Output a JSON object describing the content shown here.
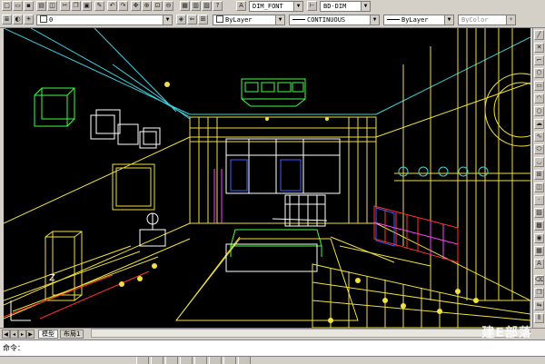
{
  "toolbar": {
    "layer_name": "0",
    "dim_font": "DIM_FONT",
    "dim_style": "BD-DIM",
    "color": "ByLayer",
    "linetype": "CONTINUOUS",
    "lineweight": "ByLayer",
    "plotstyle": "ByColor"
  },
  "tabs": {
    "model": "模型",
    "layout1": "布局1"
  },
  "command": {
    "prompt": "命令："
  },
  "watermark": {
    "brand": "建E部落",
    "url": "jiane86.com"
  },
  "ucs": {
    "axis_label": "Z"
  },
  "colors": {
    "viewport_bg": "#000000",
    "wire_yellow": "#f0e040",
    "wire_white": "#ffffff",
    "wire_cyan": "#40d0e0",
    "wire_green": "#40ff40",
    "wire_magenta": "#ff40ff",
    "wire_red": "#ff3030",
    "wire_blue": "#4060ff",
    "wire_orange": "#e09040"
  }
}
